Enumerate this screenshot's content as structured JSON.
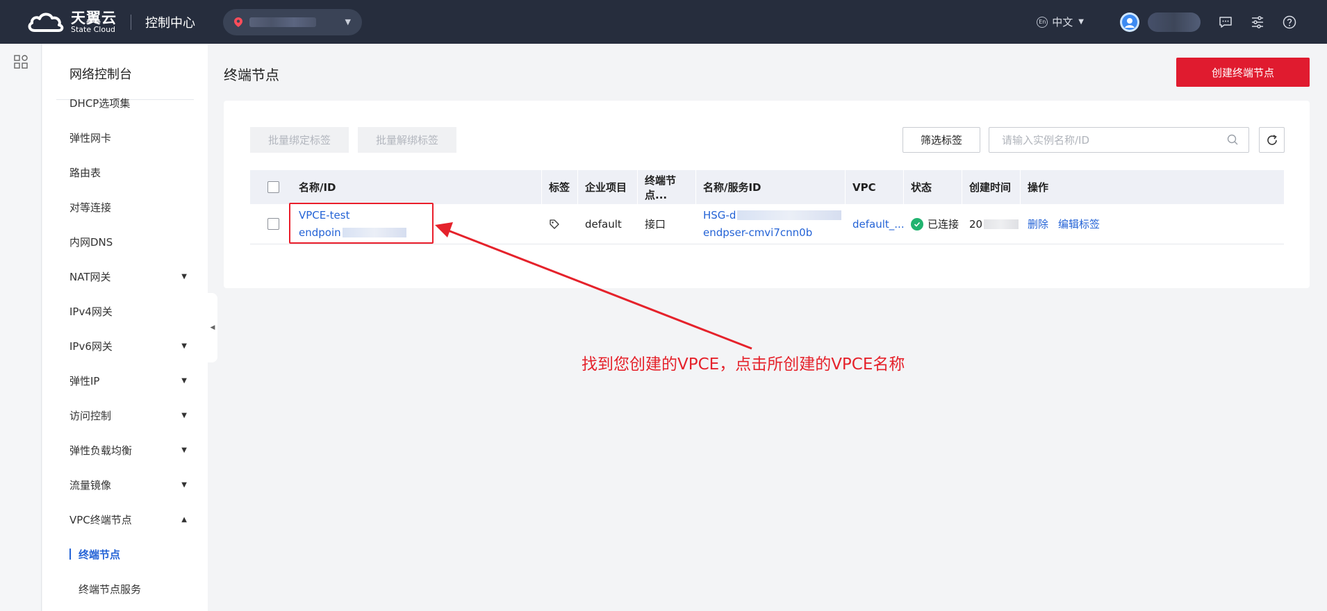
{
  "header": {
    "logo_cn": "天翼云",
    "logo_en": "State Cloud",
    "console_title": "控制中心",
    "lang_icon": "En",
    "lang_label": "中文"
  },
  "sidebar": {
    "title": "网络控制台",
    "items": [
      {
        "label": "DHCP选项集",
        "caret": ""
      },
      {
        "label": "弹性网卡",
        "caret": ""
      },
      {
        "label": "路由表",
        "caret": ""
      },
      {
        "label": "对等连接",
        "caret": ""
      },
      {
        "label": "内网DNS",
        "caret": ""
      },
      {
        "label": "NAT网关",
        "caret": "▼"
      },
      {
        "label": "IPv4网关",
        "caret": ""
      },
      {
        "label": "IPv6网关",
        "caret": "▼"
      },
      {
        "label": "弹性IP",
        "caret": "▼"
      },
      {
        "label": "访问控制",
        "caret": "▼"
      },
      {
        "label": "弹性负载均衡",
        "caret": "▼"
      },
      {
        "label": "流量镜像",
        "caret": "▼"
      },
      {
        "label": "VPC终端节点",
        "caret": "▲"
      }
    ],
    "subitems": [
      {
        "label": "终端节点",
        "active": true
      },
      {
        "label": "终端节点服务",
        "active": false
      }
    ]
  },
  "main": {
    "page_title": "终端节点",
    "create_button": "创建终端节点",
    "batch_bind_tag": "批量绑定标签",
    "batch_unbind_tag": "批量解绑标签",
    "filter_tag": "筛选标签",
    "search_placeholder": "请输入实例名称/ID"
  },
  "table": {
    "headers": [
      "名称/ID",
      "标签",
      "企业项目",
      "终端节点...",
      "名称/服务ID",
      "VPC",
      "状态",
      "创建时间",
      "操作"
    ],
    "rows": [
      {
        "name": "VPCE-test",
        "id_prefix": "endpoin",
        "enterprise_project": "default",
        "endpoint_type": "接口",
        "service_name_prefix": "HSG-d",
        "service_id": "endpser-cmvi7cnn0b",
        "vpc": "default_...",
        "status": "已连接",
        "created_prefix": "20",
        "action_delete": "删除",
        "action_edit_tags": "编辑标签"
      }
    ]
  },
  "annotation": {
    "text": "找到您创建的VPCE，点击所创建的VPCE名称",
    "color": "#e5222b"
  },
  "colors": {
    "topbar": "#262d3d",
    "primary_red": "#e01b2f",
    "link_blue": "#2463d6",
    "status_green": "#21b36f"
  }
}
